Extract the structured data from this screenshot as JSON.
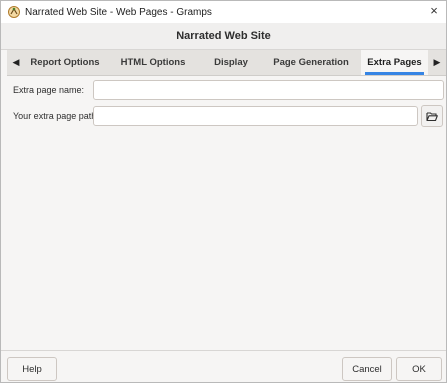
{
  "window": {
    "title": "Narrated Web Site - Web Pages - Gramps",
    "close_glyph": "×"
  },
  "header": {
    "title": "Narrated Web Site"
  },
  "tabs": {
    "left_arrow": "◀",
    "right_arrow": "▶",
    "items": [
      {
        "label": "Report Options"
      },
      {
        "label": "HTML Options"
      },
      {
        "label": "Display"
      },
      {
        "label": "Page Generation"
      },
      {
        "label": "Extra Pages"
      }
    ],
    "active_index": 4
  },
  "form": {
    "extra_page_name": {
      "label": "Extra page name:",
      "value": ""
    },
    "extra_page_path": {
      "label": "Your extra page path:",
      "value": "",
      "browse_icon": "folder-open-icon"
    }
  },
  "footer": {
    "help_label": "Help",
    "cancel_label": "Cancel",
    "ok_label": "OK"
  },
  "colors": {
    "accent": "#3584e4",
    "background": "#f6f5f4"
  }
}
